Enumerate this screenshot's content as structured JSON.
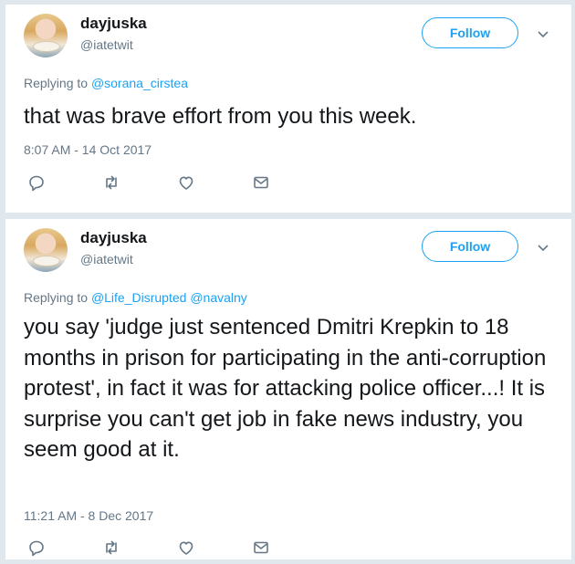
{
  "tweets": [
    {
      "name": "dayjuska",
      "handle": "@iatetwit",
      "follow_label": "Follow",
      "replying_prefix": "Replying to",
      "mentions": [
        "@sorana_cirstea"
      ],
      "text": "that was brave effort from you this week.",
      "timestamp": "8:07 AM - 14 Oct 2017"
    },
    {
      "name": "dayjuska",
      "handle": "@iatetwit",
      "follow_label": "Follow",
      "replying_prefix": "Replying to",
      "mentions": [
        "@Life_Disrupted",
        "@navalny"
      ],
      "text": "you say 'judge just sentenced Dmitri Krepkin to 18 months in prison for participating in the anti-corruption protest', in fact it was for attacking police officer...! It is surprise you can't get job in fake news industry, you seem good at it.",
      "timestamp": "11:21 AM - 8 Dec 2017"
    }
  ],
  "icons": [
    "reply-icon",
    "retweet-icon",
    "like-icon",
    "message-icon",
    "chevron-down-icon"
  ],
  "colors": {
    "accent": "#1da1f2",
    "secondary_text": "#657786",
    "primary_text": "#14171a",
    "background": "#e1e8ed"
  }
}
